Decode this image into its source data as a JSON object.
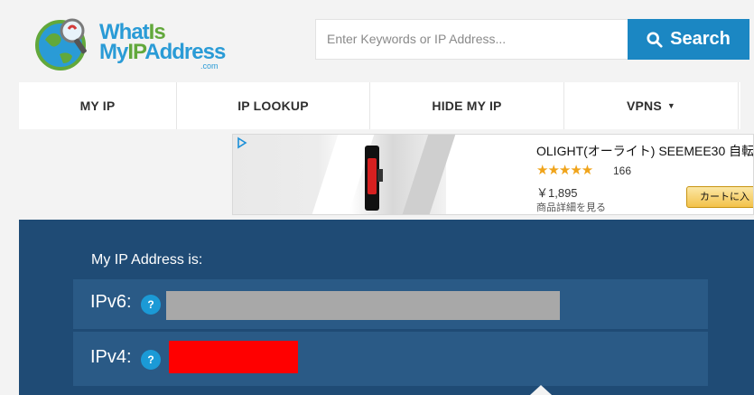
{
  "header": {
    "logo": {
      "line1_a": "What",
      "line1_b": "Is",
      "line2_a": "My",
      "line2_b": "IP",
      "line2_c": "Address",
      "suffix": ".com",
      "icon": "globe-magnifier-icon"
    },
    "search": {
      "placeholder": "Enter Keywords or IP Address...",
      "button_label": "Search",
      "button_icon": "search-icon"
    }
  },
  "nav": {
    "items": [
      {
        "label": "MY IP"
      },
      {
        "label": "IP LOOKUP"
      },
      {
        "label": "HIDE MY IP"
      },
      {
        "label": "VPNS",
        "caret": "▼"
      }
    ]
  },
  "ad": {
    "choices_icon": "ad-choices-icon",
    "title": "OLIGHT(オーライト) SEEMEE30 自転",
    "stars": "★★★★★",
    "rating": 4.5,
    "review_count": "166",
    "price": "￥1,895",
    "details_link": "商品詳細を見る",
    "cart_button": "カートに入"
  },
  "ip_panel": {
    "heading": "My IP Address is:",
    "rows": [
      {
        "label": "IPv6:",
        "help": "?"
      },
      {
        "label": "IPv4:",
        "help": "?"
      }
    ]
  },
  "colors": {
    "brand_blue": "#1b87c3",
    "logo_green": "#62a83b",
    "panel_bg": "#1f4b75",
    "row_bg": "#2a5a86",
    "help_badge": "#1b9ad6"
  }
}
